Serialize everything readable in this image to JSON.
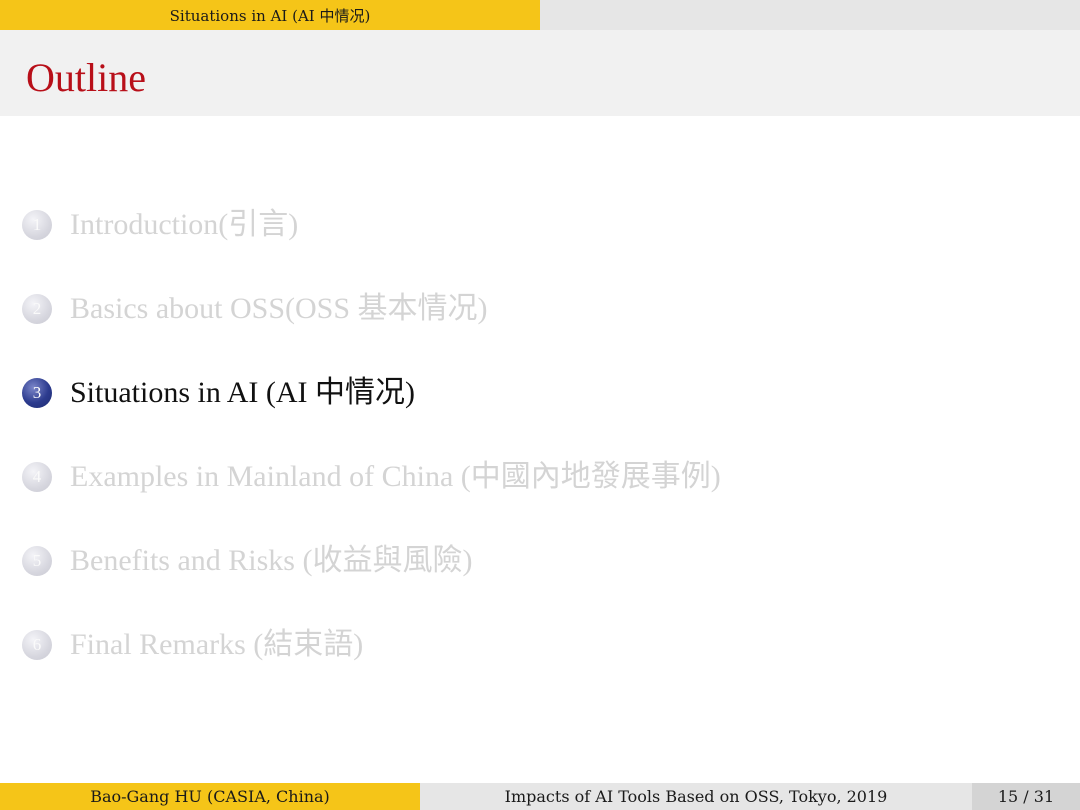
{
  "header": {
    "section": "Situations in AI (AI 中情况)"
  },
  "frame": {
    "title": "Outline"
  },
  "outline": {
    "items": [
      {
        "number": "1",
        "label": "Introduction(引言)",
        "state": "inactive"
      },
      {
        "number": "2",
        "label": "Basics about OSS(OSS 基本情况)",
        "state": "inactive"
      },
      {
        "number": "3",
        "label": "Situations in AI (AI 中情况)",
        "state": "active"
      },
      {
        "number": "4",
        "label": "Examples in Mainland of China (中國內地發展事例)",
        "state": "inactive"
      },
      {
        "number": "5",
        "label": "Benefits and Risks (收益與風險)",
        "state": "inactive"
      },
      {
        "number": "6",
        "label": "Final Remarks (結束語)",
        "state": "inactive"
      }
    ]
  },
  "footer": {
    "author": "Bao-Gang HU (CASIA, China)",
    "talk_title": "Impacts of AI Tools Based on OSS, Tokyo, 2019",
    "page": "15 / 31"
  },
  "colors": {
    "accent_yellow": "#f5c518",
    "title_red": "#b80f19",
    "active_ball": "#2c3b8e",
    "inactive_text": "#d4d4d4"
  }
}
